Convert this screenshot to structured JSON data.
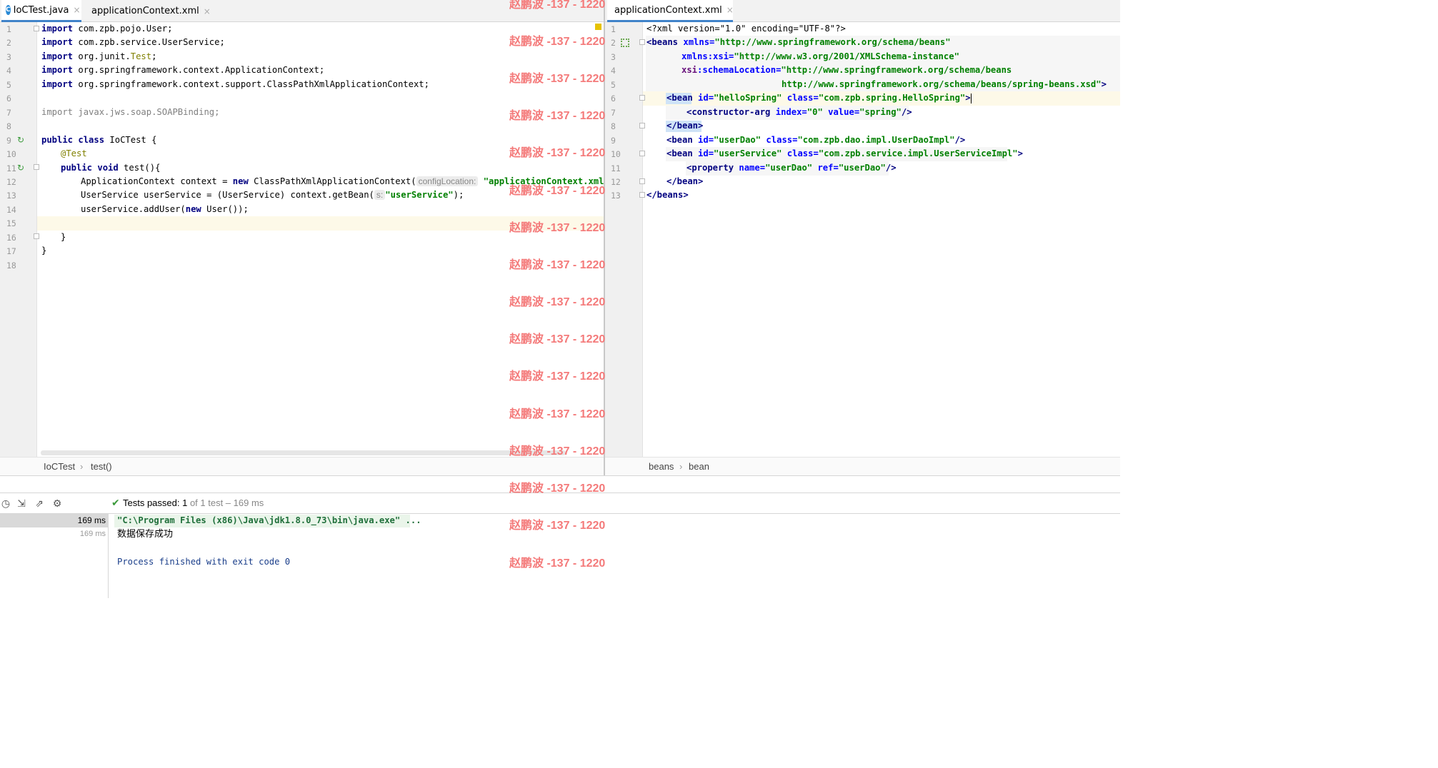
{
  "left_editor": {
    "tabs": [
      {
        "label": "IoCTest.java",
        "close": "×"
      },
      {
        "label": "applicationContext.xml",
        "close": "×"
      }
    ],
    "line_numbers": [
      "1",
      "2",
      "3",
      "4",
      "5",
      "6",
      "7",
      "8",
      "9",
      "10",
      "11",
      "12",
      "13",
      "14",
      "15",
      "16",
      "17",
      "18"
    ],
    "code": {
      "l1_kw": "import",
      "l1_rest": " com.zpb.pojo.User;",
      "l2_kw": "import",
      "l2_rest": " com.zpb.service.UserService;",
      "l3_kw": "import",
      "l3_rest": " org.junit.",
      "l3_test": "Test",
      "l3_end": ";",
      "l4_kw": "import",
      "l4_rest": " org.springframework.context.ApplicationContext;",
      "l5_kw": "import",
      "l5_rest": " org.springframework.context.support.ClassPathXmlApplicationContext;",
      "l7_kw": "import",
      "l7_rest": " javax.jws.soap.SOAPBinding;",
      "l9_kw": "public class",
      "l9_rest": " IoCTest {",
      "l10_ann": "@Test",
      "l11_kw": "public void",
      "l11_rest": " test(){",
      "l12_a": "ApplicationContext context = ",
      "l12_new": "new",
      "l12_b": " ClassPathXmlApplicationContext(",
      "l12_hint": "configLocation:",
      "l12_str": "\"applicationContext.xml\"",
      "l12_end": ");",
      "l13_a": "UserService userService = (UserService) context.getBean(",
      "l13_hint": "s:",
      "l13_str": "\"userService\"",
      "l13_end": ");",
      "l14_a": "userService.addUser(",
      "l14_new": "new",
      "l14_b": " User());",
      "l16": "}",
      "l17": "}"
    },
    "breadcrumb": [
      "IoCTest",
      "test()"
    ]
  },
  "right_editor": {
    "tabs": [
      {
        "label": "applicationContext.xml",
        "close": "×"
      }
    ],
    "line_numbers": [
      "1",
      "2",
      "3",
      "4",
      "5",
      "6",
      "7",
      "8",
      "9",
      "10",
      "11",
      "12",
      "13"
    ],
    "xml": {
      "l1": "<?xml version=\"1.0\" encoding=\"UTF-8\"?>",
      "l2_tag": "<beans",
      "l2_attr": " xmlns=",
      "l2_val": "\"http://www.springframework.org/schema/beans\"",
      "l3_ns": "xmlns",
      "l3_colon": ":",
      "l3_attr": "xsi=",
      "l3_val": "\"http://www.w3.org/2001/XMLSchema-instance\"",
      "l4_ns": "xsi",
      "l4_colon": ":",
      "l4_attr": "schemaLocation=",
      "l4_val": "\"http://www.springframework.org/schema/beans",
      "l5_val": "http://www.springframework.org/schema/beans/spring-beans.xsd\"",
      "l5_end": ">",
      "l6_tag": "<bean",
      "l6_a1": " id=",
      "l6_v1": "\"helloSpring\"",
      "l6_a2": " class=",
      "l6_v2": "\"com.zpb.spring.HelloSpring\"",
      "l6_end": ">",
      "l7_tag": "<constructor-arg",
      "l7_a1": " index=",
      "l7_v1": "\"0\"",
      "l7_a2": " value=",
      "l7_v2": "\"spring\"",
      "l7_end": "/>",
      "l8": "</bean>",
      "l9_tag": "<bean",
      "l9_a1": " id=",
      "l9_v1": "\"userDao\"",
      "l9_a2": " class=",
      "l9_v2": "\"com.zpb.dao.impl.UserDaoImpl\"",
      "l9_end": "/>",
      "l10_tag": "<bean",
      "l10_a1": " id=",
      "l10_v1": "\"userService\"",
      "l10_a2": " class=",
      "l10_v2": "\"com.zpb.service.impl.UserServiceImpl\"",
      "l10_end": ">",
      "l11_tag": "<property",
      "l11_a1": " name=",
      "l11_v1": "\"userDao\"",
      "l11_a2": " ref=",
      "l11_v2": "\"userDao\"",
      "l11_end": "/>",
      "l12": "</bean>",
      "l13": "</beans>"
    },
    "breadcrumb": [
      "beans",
      "bean"
    ]
  },
  "run_panel": {
    "status_bold": "Tests passed: 1",
    "status_rest": " of 1 test – 169 ms",
    "times": [
      "169 ms",
      "169 ms"
    ],
    "output": [
      "\"C:\\Program Files (x86)\\Java\\jdk1.8.0_73\\bin\\java.exe\" ...",
      "数据保存成功",
      "",
      "Process finished with exit code 0"
    ]
  },
  "watermark": "赵鹏波 -137 - 1220",
  "colors": {
    "accent": "#4083c9",
    "watermark": "#f47a7a",
    "current_line": "#fdf9e8",
    "pass": "#3a9a3a"
  }
}
